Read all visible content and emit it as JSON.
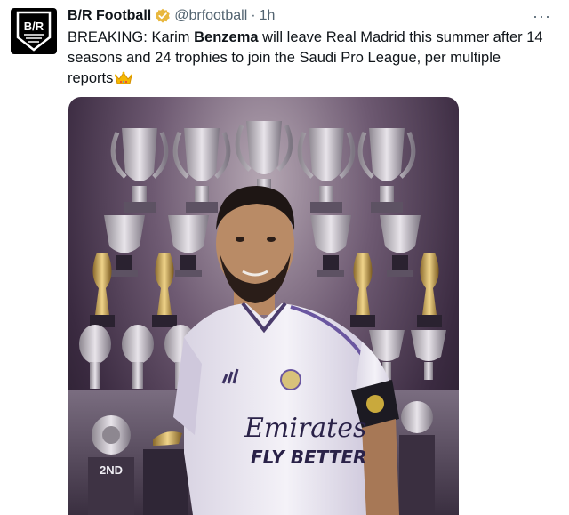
{
  "author": {
    "name": "B/R Football",
    "handle": "@brfootball",
    "separator": "·",
    "time": "1h",
    "logo_text": "B/R"
  },
  "tweet": {
    "text_before": "BREAKING: Karim ",
    "text_bold": "Benzema",
    "text_after": " will leave Real Madrid this summer after 14 seasons and 24 trophies to join the Saudi Pro League, per multiple reports"
  },
  "more_icon": "···",
  "image": {
    "jersey_sponsor_line1": "Emirates",
    "jersey_sponsor_line2": "FLY BETTER",
    "plaque_text": "2ND"
  },
  "colors": {
    "verified": "#e8b73d",
    "text": "#0f1419",
    "muted": "#536471"
  }
}
